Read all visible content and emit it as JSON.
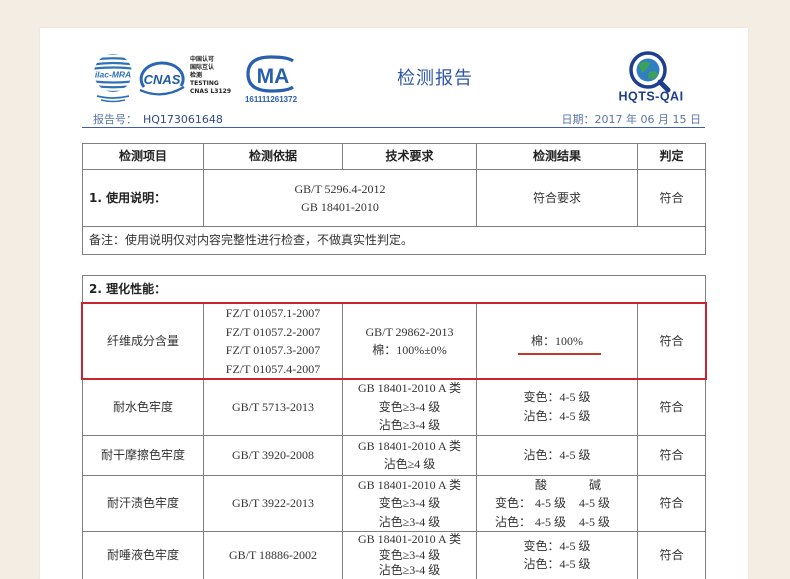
{
  "document": {
    "title": "检测报告",
    "report_number_label": "报告号：",
    "report_number": "HQ173061648",
    "date": "日期：2017 年 06 月 15 日"
  },
  "logos": {
    "ilac": "ilac-MRA",
    "cnas": "CNAS",
    "cnas_caption": [
      "中国认可",
      "国际互认",
      "检测",
      "TESTING",
      "CNAS L3129"
    ],
    "cma": "MA",
    "cma_number": "161111261372",
    "hqts": "HQTS-QAI"
  },
  "icons": {
    "ilac": "ilac-mra-globe-logo",
    "cnas": "cnas-logo",
    "cma": "cma-logo",
    "hqts": "hqts-magnifier-globe-logo"
  },
  "colors": {
    "background": "#f4ede4",
    "paper": "#ffffff",
    "title_blue": "#2d58a8",
    "rule_blue": "#3a5ea8",
    "text": "#333333",
    "table_border": "#7f7f7f",
    "highlight_red": "#c8262e"
  },
  "table1": {
    "columns": [
      "检测项目",
      "检测依据",
      "技术要求",
      "检测结果",
      "判定"
    ],
    "rows": [
      {
        "item": "1. 使用说明：",
        "basis": [
          "GB/T 5296.4-2012",
          "GB 18401-2010"
        ],
        "result": "符合要求",
        "verdict": "符合"
      }
    ],
    "remark": "备注：使用说明仅对内容完整性进行检查，不做真实性判定。"
  },
  "table2": {
    "section": "2. 理化性能：",
    "rows": [
      {
        "item": "纤维成分含量",
        "basis": [
          "FZ/T 01057.1-2007",
          "FZ/T 01057.2-2007",
          "FZ/T 01057.3-2007",
          "FZ/T 01057.4-2007"
        ],
        "requirement": [
          "GB/T 29862-2013",
          "棉：100%±0%"
        ],
        "result": [
          "棉：100%"
        ],
        "verdict": "符合",
        "highlighted": true
      },
      {
        "item": "耐水色牢度",
        "basis": [
          "GB/T 5713-2013"
        ],
        "requirement": [
          "GB 18401-2010 A 类",
          "变色≥3-4 级",
          "沾色≥3-4 级"
        ],
        "result": [
          "变色：4-5 级",
          "沾色：4-5 级"
        ],
        "verdict": "符合"
      },
      {
        "item": "耐干摩擦色牢度",
        "basis": [
          "GB/T 3920-2008"
        ],
        "requirement": [
          "GB 18401-2010 A 类",
          "沾色≥4 级"
        ],
        "result": [
          "沾色：4-5 级"
        ],
        "verdict": "符合"
      },
      {
        "item": "耐汗渍色牢度",
        "basis": [
          "GB/T 3922-2013"
        ],
        "requirement": [
          "GB 18401-2010 A 类",
          "变色≥3-4 级",
          "沾色≥3-4 级"
        ],
        "result_grid": {
          "headers": [
            "酸",
            "碱"
          ],
          "rows": [
            {
              "label": "变色：",
              "values": [
                "4-5 级",
                "4-5 级"
              ]
            },
            {
              "label": "沾色：",
              "values": [
                "4-5 级",
                "4-5 级"
              ]
            }
          ]
        },
        "verdict": "符合"
      },
      {
        "item": "耐唾液色牢度",
        "basis": [
          "GB/T 18886-2002"
        ],
        "requirement": [
          "GB 18401-2010 A 类",
          "变色≥3-4 级",
          "沾色≥3-4 级"
        ],
        "result": [
          "变色：4-5 级",
          "沾色：4-5 级"
        ],
        "verdict": "符合"
      }
    ]
  }
}
